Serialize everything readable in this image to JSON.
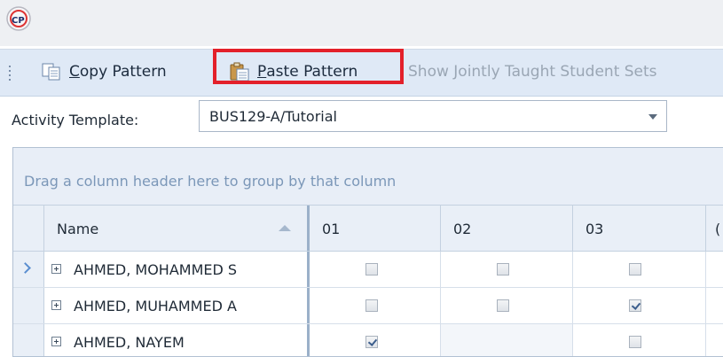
{
  "app": {
    "icon": "cp-logo-icon"
  },
  "toolbar": {
    "copy_label_underlined": "C",
    "copy_label_rest": "opy Pattern",
    "paste_label_underlined": "P",
    "paste_label_rest": "aste Pattern",
    "show_jointly_label": "Show Jointly Taught Student Sets"
  },
  "activity": {
    "label": "Activity Template:",
    "value": "BUS129-A/Tutorial"
  },
  "grid": {
    "group_hint": "Drag a column header here to group by that column",
    "columns": [
      "Name",
      "01",
      "02",
      "03"
    ],
    "rows": [
      {
        "name": "AHMED, MOHAMMED S",
        "c01": "unchecked",
        "c02": "unchecked",
        "c03": "unchecked",
        "current": true
      },
      {
        "name": "AHMED, MUHAMMED A",
        "c01": "unchecked",
        "c02": "unchecked",
        "c03": "checked",
        "current": false
      },
      {
        "name": "AHMED, NAYEM",
        "c01": "checked",
        "c02": "none",
        "c03": "unchecked",
        "current": false
      }
    ]
  }
}
